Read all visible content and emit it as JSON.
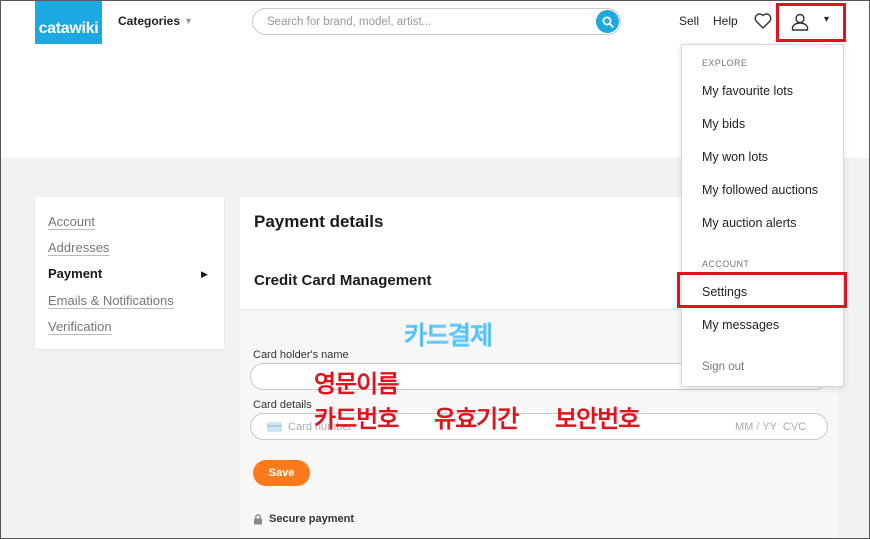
{
  "header": {
    "logo": "catawiki",
    "categories": "Categories",
    "search_placeholder": "Search for brand, model, artist...",
    "sell": "Sell",
    "help": "Help"
  },
  "sidebar": {
    "items": [
      {
        "label": "Account"
      },
      {
        "label": "Addresses"
      },
      {
        "label": "Payment"
      },
      {
        "label": "Emails & Notifications"
      },
      {
        "label": "Verification"
      }
    ]
  },
  "main": {
    "title": "Payment details",
    "subtitle": "Credit Card Management",
    "holder_label": "Card holder's name",
    "details_label": "Card details",
    "card_placeholder": "Card number",
    "expiry_cvc_placeholder": "MM / YY  CVC",
    "save_label": "Save",
    "secure_label": "Secure payment"
  },
  "annotations": {
    "card_payment": "카드결제",
    "english_name": "영문이름",
    "card_number": "카드번호",
    "expiry": "유효기간",
    "security_code": "보안번호"
  },
  "dropdown": {
    "explore_heading": "EXPLORE",
    "explore_items": [
      "My favourite lots",
      "My bids",
      "My won lots",
      "My followed auctions",
      "My auction alerts"
    ],
    "account_heading": "ACCOUNT",
    "account_items": [
      "Settings",
      "My messages"
    ],
    "sign_out": "Sign out"
  },
  "colors": {
    "brand": "#1ca8e0",
    "save_button": "#ff7a1a",
    "highlight_box": "#e0141e"
  }
}
